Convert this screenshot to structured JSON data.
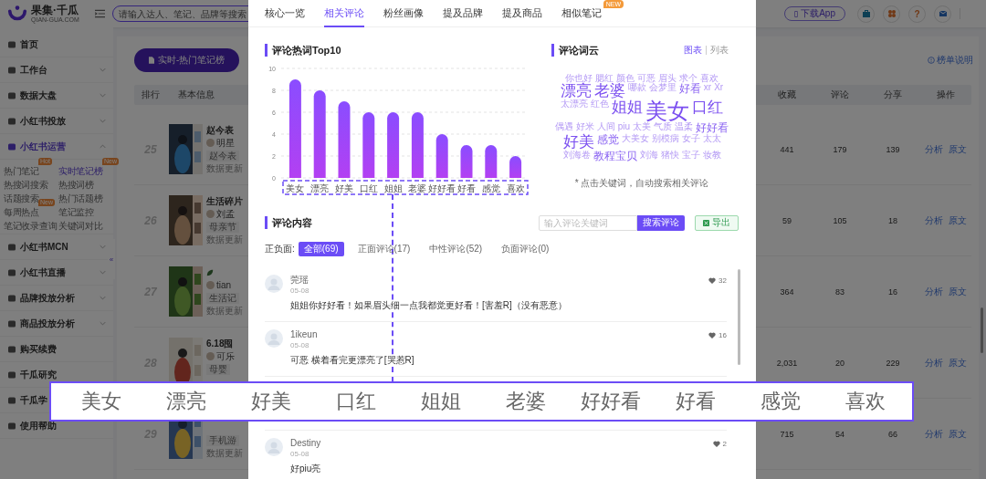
{
  "header": {
    "logo_text": "果集·千瓜",
    "logo_sub": "QIAN-GUA.COM",
    "search_placeholder": "请输入达人、笔记、品牌等搜索",
    "download_button": "下载App",
    "help_glyph": "?"
  },
  "sidebar": {
    "collapse_glyph": "«",
    "items": [
      {
        "label": "首页",
        "kind": "link",
        "selected": false
      },
      {
        "label": "工作台",
        "kind": "group",
        "expanded": false,
        "selected": false
      },
      {
        "label": "数据大盘",
        "kind": "group",
        "expanded": false,
        "selected": false
      },
      {
        "label": "小红书投放",
        "kind": "group",
        "expanded": false,
        "selected": false
      },
      {
        "label": "小红书运营",
        "kind": "group",
        "expanded": true,
        "selected": true,
        "children": [
          {
            "label": "热门笔记",
            "badge": "Hot",
            "selected": false
          },
          {
            "label": "实时笔记榜",
            "badge": "New",
            "selected": true
          },
          {
            "label": "热搜词搜索",
            "selected": false
          },
          {
            "label": "热搜词榜",
            "selected": false
          },
          {
            "label": "话题搜索",
            "selected": false
          },
          {
            "label": "热门话题榜",
            "selected": false
          },
          {
            "label": "每周热点",
            "badge": "New",
            "selected": false
          },
          {
            "label": "笔记监控",
            "selected": false
          },
          {
            "label": "笔记收录查询",
            "selected": false
          },
          {
            "label": "关键词对比",
            "selected": false
          }
        ]
      },
      {
        "label": "小红书MCN",
        "kind": "group",
        "expanded": false,
        "selected": false
      },
      {
        "label": "小红书直播",
        "kind": "group",
        "expanded": false,
        "selected": false
      },
      {
        "label": "品牌投放分析",
        "kind": "group",
        "expanded": false,
        "selected": false
      },
      {
        "label": "商品投放分析",
        "kind": "group",
        "expanded": false,
        "selected": false
      },
      {
        "label": "购买续费",
        "kind": "link",
        "selected": false
      },
      {
        "label": "千瓜研究",
        "kind": "link",
        "selected": false
      },
      {
        "label": "千瓜学",
        "kind": "link",
        "selected": false
      },
      {
        "label": "使用帮助",
        "kind": "link",
        "selected": false
      }
    ]
  },
  "main": {
    "ranking_button": "实时-热门笔记榜",
    "help_link": "榜单说明",
    "table": {
      "columns": [
        "排行",
        "基本信息",
        "收藏",
        "评论",
        "分享",
        "操作"
      ],
      "rows": [
        {
          "rank": "25",
          "title": "赵今表",
          "title_icon": false,
          "author": "明星",
          "tag": "赵今表",
          "update": "数据更新",
          "collects": "441",
          "comments": "179",
          "shares": "139",
          "actions": [
            "分析",
            "原文"
          ]
        },
        {
          "rank": "26",
          "title": "生活碎片",
          "title_icon": false,
          "author": "刘孟",
          "tag": "母亲节",
          "update": "数据更新",
          "collects": "59",
          "comments": "105",
          "shares": "18",
          "actions": [
            "分析",
            "原文"
          ]
        },
        {
          "rank": "27",
          "title_icon": true,
          "author": "tian",
          "tag": "生活记",
          "update": "数据更新",
          "collects": "364",
          "comments": "83",
          "shares": "16",
          "actions": [
            "分析",
            "原文"
          ]
        },
        {
          "rank": "28",
          "title": "6.18囤",
          "title_icon": false,
          "author": "可乐",
          "tag": "母婴",
          "collects": "2,031",
          "comments": "20",
          "shares": "229",
          "actions": [
            "分析",
            "原文"
          ]
        },
        {
          "rank": "29",
          "tag": "手机游",
          "update": "数据更新",
          "collects": "715",
          "comments": "54",
          "shares": "66",
          "actions": [
            "分析",
            "原文"
          ]
        }
      ]
    }
  },
  "modal": {
    "tabs": [
      {
        "label": "核心一览",
        "selected": false
      },
      {
        "label": "相关评论",
        "selected": true
      },
      {
        "label": "粉丝画像",
        "selected": false
      },
      {
        "label": "提及品牌",
        "selected": false
      },
      {
        "label": "提及商品",
        "selected": false
      },
      {
        "label": "相似笔记",
        "selected": false,
        "badge": "NEW"
      }
    ],
    "hot_words": {
      "chart_data": {
        "type": "bar",
        "title": "评论热词Top10",
        "categories": [
          "美女",
          "漂亮",
          "好美",
          "口红",
          "姐姐",
          "老婆",
          "好好看",
          "好看",
          "感觉",
          "喜欢"
        ],
        "values": [
          9,
          8,
          7,
          6,
          6,
          6,
          4,
          3,
          3,
          2
        ],
        "grid": true,
        "ylim": [
          0,
          10
        ],
        "yticks": [
          0,
          2,
          4,
          6,
          8,
          10
        ]
      }
    },
    "word_cloud": {
      "title": "评论词云",
      "view_toggle": [
        {
          "label": "图表",
          "selected": true
        },
        {
          "label": "列表",
          "selected": false
        }
      ],
      "footnote": "* 点击关键词，自动搜索相关评论",
      "words": [
        {
          "text": "你也好",
          "kind": "small"
        },
        {
          "text": "腮红",
          "kind": "small"
        },
        {
          "text": "颜色",
          "kind": "small"
        },
        {
          "text": "可恶",
          "kind": "small"
        },
        {
          "text": "眉头",
          "kind": "small"
        },
        {
          "text": "求个",
          "kind": "small"
        },
        {
          "text": "喜欢",
          "kind": "small"
        },
        {
          "text": "漂亮",
          "kind": "large"
        },
        {
          "text": "老婆",
          "kind": "large"
        },
        {
          "text": "哪款",
          "kind": "small"
        },
        {
          "text": "会梦里",
          "kind": "small"
        },
        {
          "text": "好看",
          "kind": "medium"
        },
        {
          "text": "xr",
          "kind": "small"
        },
        {
          "text": "Xr",
          "kind": "small"
        },
        {
          "text": "太漂亮",
          "kind": "small"
        },
        {
          "text": "红色",
          "kind": "small"
        },
        {
          "text": "姐姐",
          "kind": "large"
        },
        {
          "text": "美女",
          "kind": "xlarge"
        },
        {
          "text": "口红",
          "kind": "large"
        },
        {
          "text": "偶遇",
          "kind": "small"
        },
        {
          "text": "好米",
          "kind": "small"
        },
        {
          "text": "人间",
          "kind": "small"
        },
        {
          "text": "piu",
          "kind": "small"
        },
        {
          "text": "太美",
          "kind": "small"
        },
        {
          "text": "气质",
          "kind": "small"
        },
        {
          "text": "温柔",
          "kind": "small"
        },
        {
          "text": "好好看",
          "kind": "medium"
        },
        {
          "text": "好美",
          "kind": "large"
        },
        {
          "text": "感觉",
          "kind": "medium"
        },
        {
          "text": "大美女",
          "kind": "small"
        },
        {
          "text": "别模病",
          "kind": "small"
        },
        {
          "text": "女子",
          "kind": "small"
        },
        {
          "text": "太太",
          "kind": "small"
        },
        {
          "text": "刘海卷",
          "kind": "small"
        },
        {
          "text": "教程宝贝",
          "kind": "medium"
        },
        {
          "text": "刘海",
          "kind": "small"
        },
        {
          "text": "猪快",
          "kind": "small"
        },
        {
          "text": "宝子",
          "kind": "small"
        },
        {
          "text": "妆教",
          "kind": "small"
        }
      ]
    },
    "comments": {
      "title": "评论内容",
      "search_placeholder": "输入评论关键词",
      "search_button": "搜索评论",
      "export_button": "导出",
      "filter_label": "正负面:",
      "filters": [
        {
          "label": "全部(69)",
          "selected": true
        },
        {
          "label": "正面评论(17)",
          "selected": false
        },
        {
          "label": "中性评论(52)",
          "selected": false
        },
        {
          "label": "负面评论(0)",
          "selected": false
        }
      ],
      "items": [
        {
          "user": "莞瑶",
          "date": "05-08",
          "text": "姐姐你好好看！如果眉头细一点我都觉更好看！[害羞R]（没有恶意）",
          "likes": "32"
        },
        {
          "user": "1ikeun",
          "date": "05-08",
          "text": "可恶 横着看完更漂亮了[哭惹R]",
          "likes": "16"
        },
        {
          "user": "Destiny",
          "date": "05-08",
          "text": "好piu亮",
          "likes": "2"
        }
      ]
    }
  },
  "zoom_labels": [
    "美女",
    "漂亮",
    "好美",
    "口红",
    "姐姐",
    "老婆",
    "好好看",
    "好看",
    "感觉",
    "喜欢"
  ]
}
